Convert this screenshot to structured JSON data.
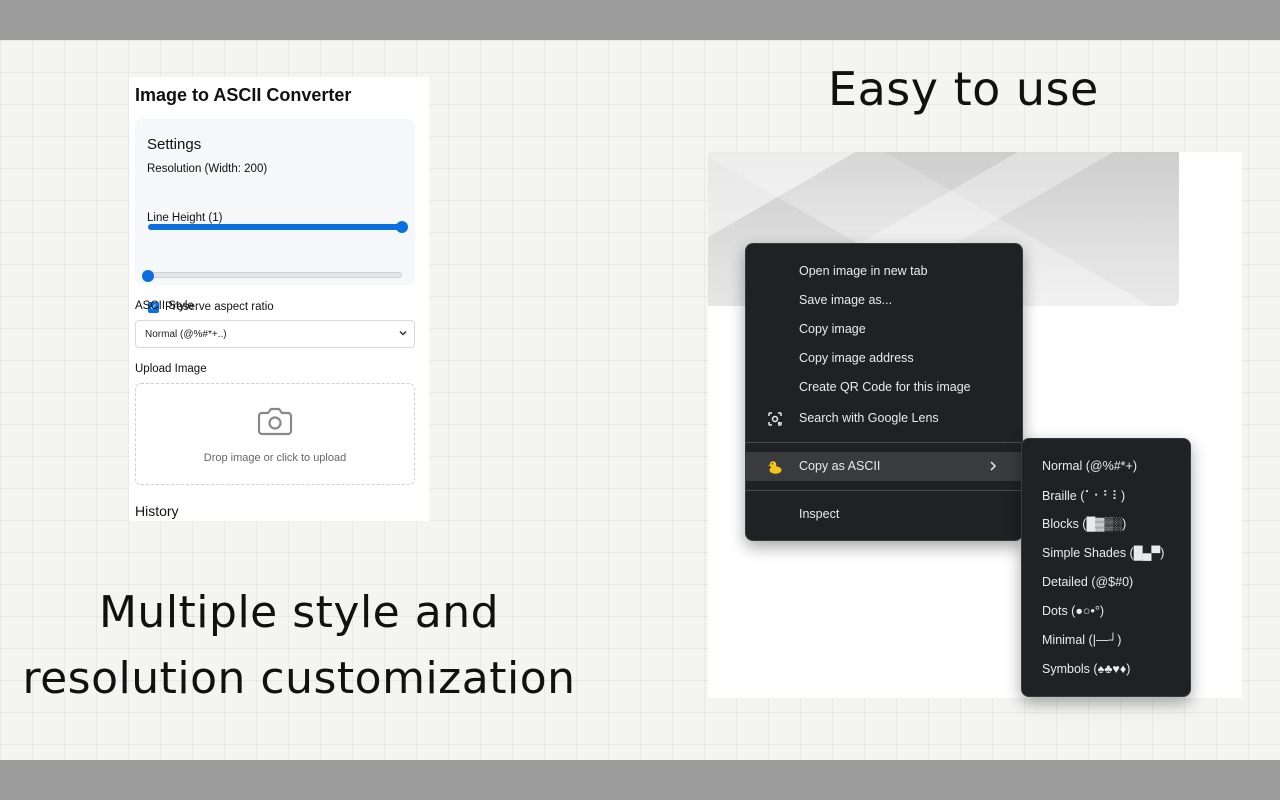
{
  "headlines": {
    "right": "Easy to use",
    "left_line1": "Multiple style and",
    "left_line2": "resolution customization"
  },
  "panel": {
    "title": "Image to ASCII Converter",
    "settings_title": "Settings",
    "resolution_label": "Resolution (Width: 200)",
    "resolution_level": 1.0,
    "line_height_label": "Line Height (1)",
    "line_height_level": 0.0,
    "preserve_aspect_label": "Preserve aspect ratio",
    "preserve_aspect_checked": true,
    "ascii_style_label": "ASCII Style",
    "ascii_style_value": "Normal (@%#*+..)",
    "upload_label": "Upload Image",
    "drop_text": "Drop image or click to upload",
    "history_title": "History"
  },
  "context_menu": {
    "items": [
      "Open image in new tab",
      "Save image as...",
      "Copy image",
      "Copy image address",
      "Create QR Code for this image"
    ],
    "lens_item": "Search with Google Lens",
    "ascii_item": "Copy as ASCII",
    "inspect_item": "Inspect",
    "icons": {
      "lens": "google-lens-icon",
      "ascii": "duck-icon",
      "submenu_arrow": "chevron-right-icon"
    }
  },
  "submenu": {
    "items": [
      "Normal (@%#*+)",
      "Braille (⠁⠂⠃⠇)",
      "Blocks (█▓▒░)",
      "Simple Shades (█▄▀)",
      "Detailed (@$#0)",
      "Dots (●○•°)",
      "Minimal (|—┘)",
      "Symbols (♠♣♥♦)"
    ]
  },
  "colors": {
    "accent": "#0b6fe0",
    "menu_bg": "#202124",
    "menu_text": "#e8eaed",
    "frame": "#9b9b9b"
  }
}
